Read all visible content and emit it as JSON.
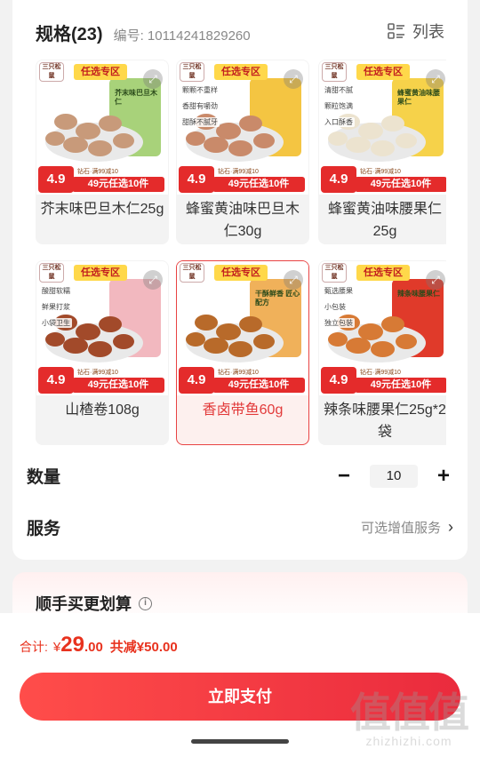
{
  "spec": {
    "title": "规格(23)",
    "code": "编号: 10114241829260",
    "list_toggle": "列表",
    "list_icon": "list-icon"
  },
  "products": [
    {
      "name": "芥末味巴旦木仁25g",
      "price_tag": "4.9",
      "promo": "49元任选10件",
      "promo_small": "钻石·满99减10",
      "zone": "任选专区",
      "bag_text": "芥末味巴旦木仁",
      "bag_color": "#a8d27a",
      "nut_color": "#c89a7a",
      "features": [],
      "selected": false
    },
    {
      "name": "蜂蜜黄油味巴旦木仁30g",
      "price_tag": "4.9",
      "promo": "49元任选10件",
      "promo_small": "钻石·满99减10",
      "zone": "任选专区",
      "bag_text": "",
      "bag_color": "#f4c542",
      "nut_color": "#c98a6a",
      "features": [
        "颗颗不重样",
        "香甜有嚼劲",
        "甜酥不腻牙"
      ],
      "selected": false
    },
    {
      "name": "蜂蜜黄油味腰果仁25g",
      "price_tag": "4.9",
      "promo": "49元任选10件",
      "promo_small": "钻石·满99减10",
      "zone": "任选专区",
      "bag_text": "蜂蜜黄油味腰果仁",
      "bag_color": "#f6d24a",
      "nut_color": "#ece3cf",
      "features": [
        "清甜不腻",
        "颗粒饱满",
        "入口酥香"
      ],
      "selected": false
    },
    {
      "name": "山楂卷108g",
      "price_tag": "4.9",
      "promo": "49元任选10件",
      "promo_small": "钻石·满99减10",
      "zone": "任选专区",
      "bag_text": "",
      "bag_color": "#f2b8bf",
      "nut_color": "#a24a2a",
      "features": [
        "酸甜软糯",
        "鲜果打浆",
        "小袋卫生"
      ],
      "selected": false
    },
    {
      "name": "香卤带鱼60g",
      "price_tag": "4.9",
      "promo": "49元任选10件",
      "promo_small": "钻石·满99减10",
      "zone": "任选专区",
      "bag_text": "干酥鲜香 匠心配方",
      "bag_color": "#f0b15a",
      "nut_color": "#b86a2a",
      "features": [],
      "selected": true
    },
    {
      "name": "辣条味腰果仁25g*2袋",
      "price_tag": "4.9",
      "promo": "49元任选10件",
      "promo_small": "钻石·满99减10",
      "zone": "任选专区",
      "bag_text": "辣条味腰果仁",
      "bag_color": "#e03a2a",
      "nut_color": "#d77a35",
      "features": [
        "甄选腰果",
        "小包装",
        "独立包装"
      ],
      "selected": false
    }
  ],
  "brand_logo_text": "三只松鼠",
  "quantity": {
    "label": "数量",
    "value": "10",
    "minus": "−",
    "plus": "+"
  },
  "service": {
    "label": "服务",
    "value": "可选增值服务",
    "chevron": "›"
  },
  "bundle": {
    "title": "顺手买更划算",
    "info": "i"
  },
  "total": {
    "label": "合计:",
    "currency": "¥",
    "integer": "29",
    "decimal": ".00",
    "saving": "共减¥50.00"
  },
  "pay_button": "立即支付",
  "watermark": {
    "glyphs": "值值值",
    "url": "zhizhizhi.com"
  }
}
